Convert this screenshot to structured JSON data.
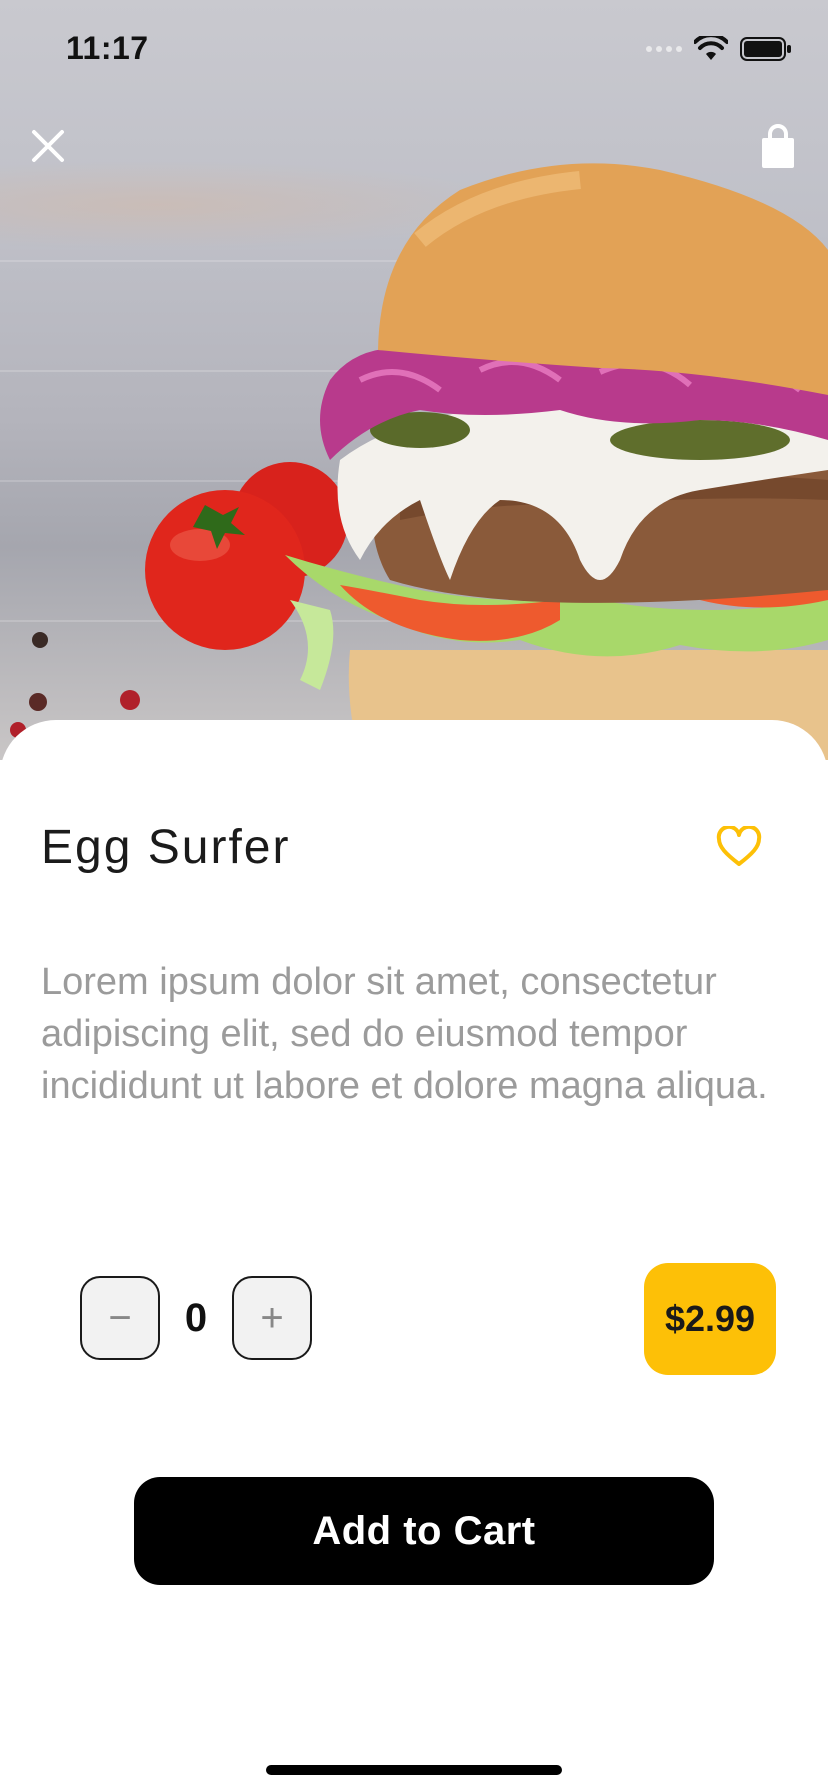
{
  "status_bar": {
    "time": "11:17"
  },
  "header": {
    "close_icon": "close-icon",
    "cart_icon": "shopping-bag-icon"
  },
  "product": {
    "name": "Egg Surfer",
    "description": "Lorem ipsum dolor sit amet, consectetur adipiscing elit, sed do eiusmod tempor incididunt ut labore et dolore magna aliqua.",
    "favorite_icon": "heart-outline-icon",
    "price": "$2.99"
  },
  "quantity": {
    "minus_label": "−",
    "value": "0",
    "plus_label": "+"
  },
  "actions": {
    "add_to_cart": "Add to Cart"
  },
  "colors": {
    "accent": "#fdc007",
    "button": "#000000",
    "heart": "#fdc007"
  }
}
